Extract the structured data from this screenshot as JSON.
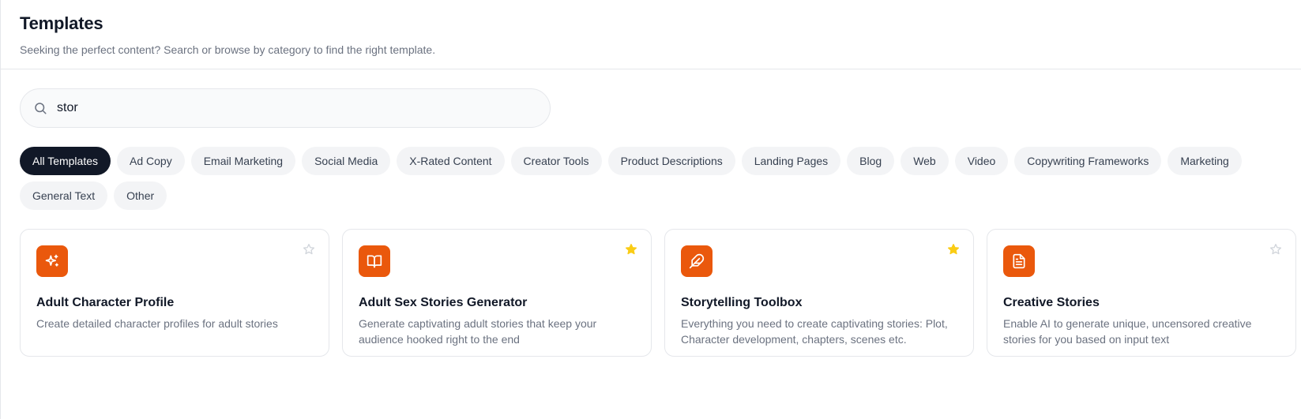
{
  "header": {
    "title": "Templates",
    "subtitle": "Seeking the perfect content? Search or browse by category to find the right template."
  },
  "search": {
    "value": "stor",
    "icon": "search-icon"
  },
  "categories": [
    {
      "label": "All Templates",
      "active": true
    },
    {
      "label": "Ad Copy",
      "active": false
    },
    {
      "label": "Email Marketing",
      "active": false
    },
    {
      "label": "Social Media",
      "active": false
    },
    {
      "label": "X-Rated Content",
      "active": false
    },
    {
      "label": "Creator Tools",
      "active": false
    },
    {
      "label": "Product Descriptions",
      "active": false
    },
    {
      "label": "Landing Pages",
      "active": false
    },
    {
      "label": "Blog",
      "active": false
    },
    {
      "label": "Web",
      "active": false
    },
    {
      "label": "Video",
      "active": false
    },
    {
      "label": "Copywriting Frameworks",
      "active": false
    },
    {
      "label": "Marketing",
      "active": false
    },
    {
      "label": "General Text",
      "active": false
    },
    {
      "label": "Other",
      "active": false
    }
  ],
  "templates": [
    {
      "title": "Adult Character Profile",
      "description": "Create detailed character profiles for adult stories",
      "icon": "sparkles-icon",
      "favorited": false
    },
    {
      "title": "Adult Sex Stories Generator",
      "description": "Generate captivating adult stories that keep your audience hooked right to the end",
      "icon": "book-open-icon",
      "favorited": true
    },
    {
      "title": "Storytelling Toolbox",
      "description": "Everything you need to create captivating stories: Plot, Character development, chapters, scenes etc.",
      "icon": "feather-icon",
      "favorited": true
    },
    {
      "title": "Creative Stories",
      "description": "Enable AI to generate unique, uncensored creative stories for you based on input text",
      "icon": "file-text-icon",
      "favorited": false
    }
  ],
  "colors": {
    "accent": "#ea580c",
    "active_chip": "#111827",
    "star_filled": "#facc15",
    "star_empty": "#d1d5db"
  }
}
